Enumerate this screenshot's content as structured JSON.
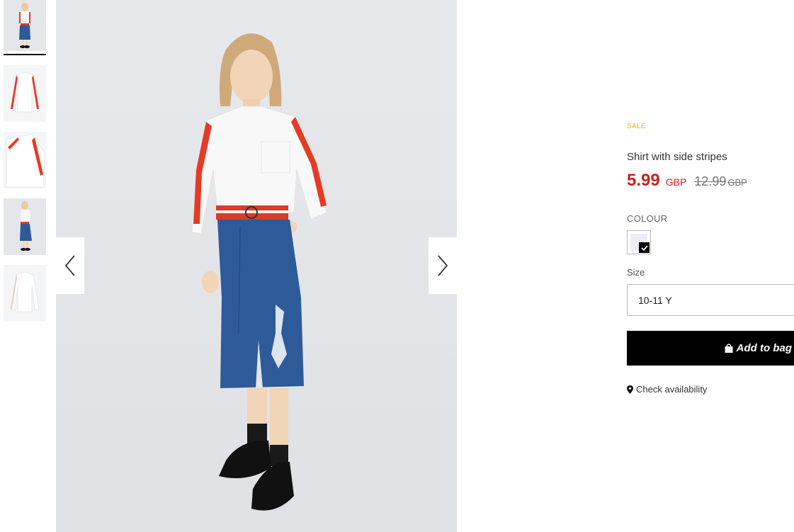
{
  "gallery": {
    "thumbnails": [
      {
        "alt": "model-front",
        "active": true
      },
      {
        "alt": "shirt-front"
      },
      {
        "alt": "shirt-detail"
      },
      {
        "alt": "model-side"
      },
      {
        "alt": "shirt-back"
      }
    ],
    "prev_icon": "chevron-left-icon",
    "next_icon": "chevron-right-icon"
  },
  "product": {
    "badge": "SALE",
    "title": "Shirt with side stripes",
    "price": "5.99",
    "price_currency": "GBP",
    "old_price": "12.99",
    "old_price_currency": "GBP",
    "colour_label": "COLOUR",
    "size_label": "Size",
    "selected_size": "10-11 Y",
    "add_to_bag": "Add to bag",
    "check_availability": "Check availability"
  },
  "colors": {
    "sale": "#f0b400",
    "price": "#cc1f1f",
    "button": "#000000"
  }
}
